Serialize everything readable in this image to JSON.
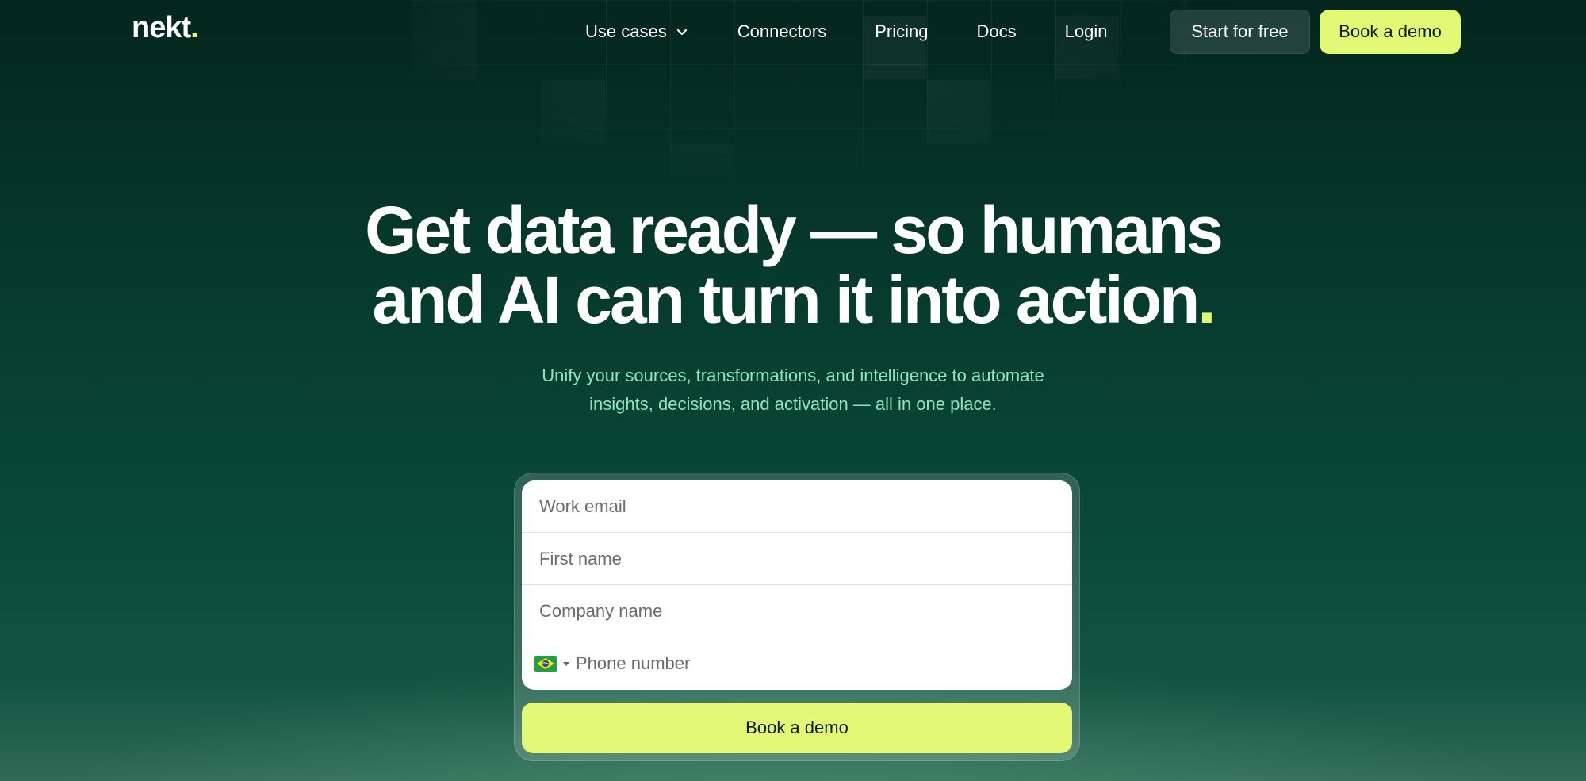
{
  "brand": {
    "name": "nekt",
    "dot": "."
  },
  "nav": {
    "links": [
      {
        "label": "Use cases",
        "has_dropdown": true
      },
      {
        "label": "Connectors"
      },
      {
        "label": "Pricing"
      },
      {
        "label": "Docs"
      },
      {
        "label": "Login"
      }
    ],
    "start_label": "Start for free",
    "demo_label": "Book a demo"
  },
  "hero": {
    "headline_line1": "Get data ready — so humans",
    "headline_line2": "and AI can turn it into action",
    "headline_dot": ".",
    "subtitle_line1": "Unify your sources, transformations, and intelligence to automate",
    "subtitle_line2": "insights, decisions, and activation — all in one place."
  },
  "form": {
    "email_placeholder": "Work email",
    "first_name_placeholder": "First name",
    "company_placeholder": "Company name",
    "phone_placeholder": "Phone number",
    "country_flag": "brazil-flag-icon",
    "submit_label": "Book a demo"
  },
  "colors": {
    "accent": "#e3f874",
    "background_top": "#04261d",
    "background_bottom": "#2f6a56",
    "subtitle": "#8ee6bd"
  }
}
